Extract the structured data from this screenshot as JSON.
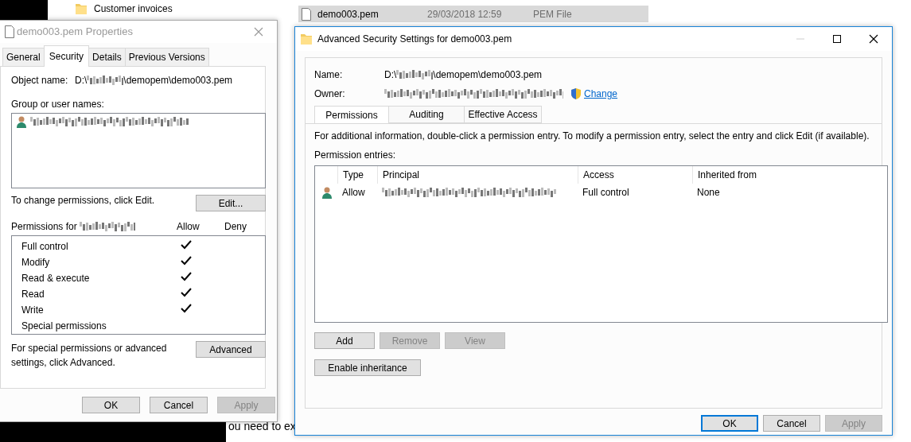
{
  "explorer": {
    "rows": [
      {
        "kind": "folder",
        "name": "Customer invoices",
        "selected": false
      },
      {
        "kind": "file",
        "name": "demo003.pem",
        "date": "29/03/2018 12:59",
        "type": "PEM File",
        "selected": true
      }
    ],
    "snippet": "ou need to ex"
  },
  "properties": {
    "title": "demo003.pem Properties",
    "tabs": [
      {
        "label": "General",
        "selected": false
      },
      {
        "label": "Security",
        "selected": true
      },
      {
        "label": "Details",
        "selected": false
      },
      {
        "label": "Previous Versions",
        "selected": false
      }
    ],
    "object_label": "Object name:",
    "object_prefix": "D:\\",
    "object_suffix": "\\demopem\\demo003.pem",
    "group_label": "Group or user names:",
    "change_hint": "To change permissions, click Edit.",
    "edit_button": "Edit...",
    "permissions_label": "Permissions for",
    "allow_header": "Allow",
    "deny_header": "Deny",
    "permissions": [
      {
        "name": "Full control",
        "allow": true,
        "deny": false
      },
      {
        "name": "Modify",
        "allow": true,
        "deny": false
      },
      {
        "name": "Read & execute",
        "allow": true,
        "deny": false
      },
      {
        "name": "Read",
        "allow": true,
        "deny": false
      },
      {
        "name": "Write",
        "allow": true,
        "deny": false
      },
      {
        "name": "Special permissions",
        "allow": false,
        "deny": false
      }
    ],
    "advanced_hint": "For special permissions or advanced settings, click Advanced.",
    "advanced_button": "Advanced",
    "buttons": [
      {
        "label": "OK",
        "disabled": false
      },
      {
        "label": "Cancel",
        "disabled": false
      },
      {
        "label": "Apply",
        "disabled": true
      }
    ]
  },
  "advanced": {
    "title": "Advanced Security Settings for demo003.pem",
    "name_label": "Name:",
    "name_prefix": "D:\\",
    "name_suffix": "\\demopem\\demo003.pem",
    "owner_label": "Owner:",
    "change_link": "Change",
    "tabs": [
      {
        "label": "Permissions",
        "selected": true
      },
      {
        "label": "Auditing",
        "selected": false
      },
      {
        "label": "Effective Access",
        "selected": false
      }
    ],
    "info": "For additional information, double-click a permission entry. To modify a permission entry, select the entry and click Edit (if available).",
    "entries_label": "Permission entries:",
    "columns": [
      "Type",
      "Principal",
      "Access",
      "Inherited from"
    ],
    "rows": [
      {
        "type": "Allow",
        "access": "Full control",
        "inherited": "None"
      }
    ],
    "actions": [
      {
        "label": "Add",
        "disabled": false
      },
      {
        "label": "Remove",
        "disabled": true
      },
      {
        "label": "View",
        "disabled": true
      }
    ],
    "inheritance_button": "Enable inheritance",
    "buttons": [
      {
        "label": "OK",
        "disabled": false,
        "default": true
      },
      {
        "label": "Cancel",
        "disabled": false,
        "default": false
      },
      {
        "label": "Apply",
        "disabled": true,
        "default": false
      }
    ]
  }
}
